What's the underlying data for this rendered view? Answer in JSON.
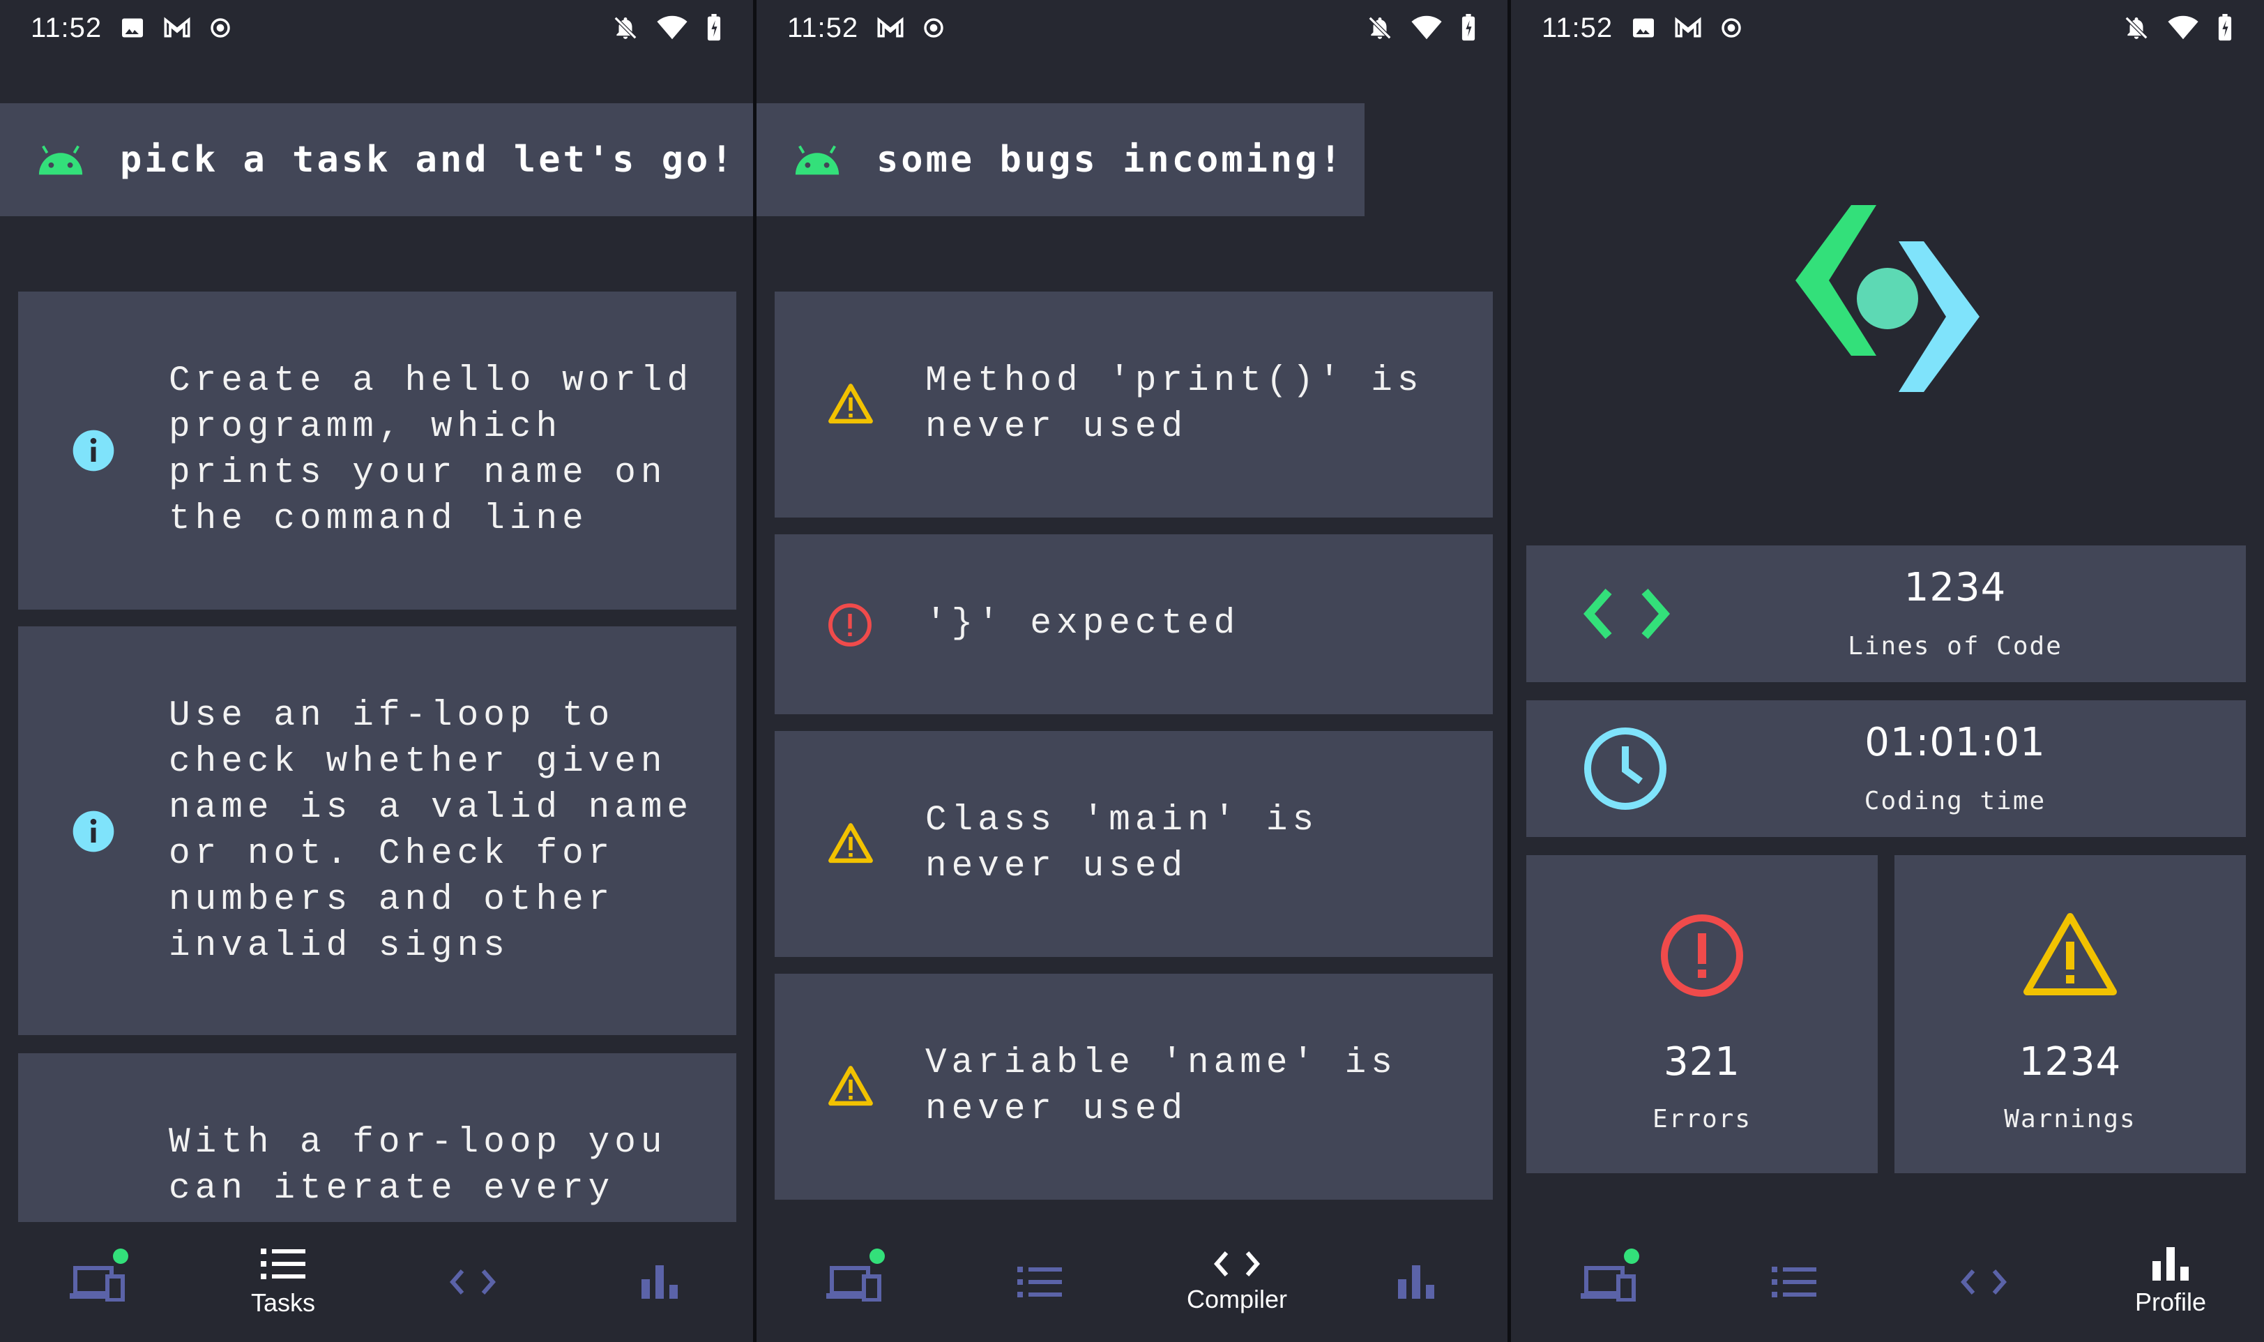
{
  "status_bar": {
    "time": "11:52"
  },
  "colors": {
    "background": "#262831",
    "card": "#424657",
    "accent_green": "#33e07a",
    "accent_cyan": "#7fe3fb",
    "error_red": "#f04b4b",
    "warning_yellow": "#f2c200",
    "nav_inactive": "#5b63a8"
  },
  "tasks_screen": {
    "banner": "pick a task and let's go!",
    "tasks": [
      {
        "icon": "info-icon",
        "text": "Create a hello world\nprogramm, which\nprints your name on\nthe command line"
      },
      {
        "icon": "info-icon",
        "text": "Use an if-loop to\ncheck whether given\nname is a valid name\nor not. Check for\nnumbers and other\ninvalid signs"
      },
      {
        "icon": "none",
        "text": "With a for-loop you\ncan iterate every"
      }
    ]
  },
  "compiler_screen": {
    "banner": "some bugs incoming!",
    "issues": [
      {
        "type": "warning",
        "icon": "warning-icon",
        "text": "Method 'print()' is\nnever used"
      },
      {
        "type": "error",
        "icon": "error-icon",
        "text": "'}' expected"
      },
      {
        "type": "warning",
        "icon": "warning-icon",
        "text": "Class 'main' is\nnever used"
      },
      {
        "type": "warning",
        "icon": "warning-icon",
        "text": "Variable 'name' is\nnever used"
      }
    ]
  },
  "profile_screen": {
    "lines_of_code": {
      "value": "1234",
      "label": "Lines of Code"
    },
    "coding_time": {
      "value": "01:01:01",
      "label": "Coding time"
    },
    "errors": {
      "value": "321",
      "label": "Errors"
    },
    "warnings": {
      "value": "1234",
      "label": "Warnings"
    }
  },
  "bottom_nav": {
    "items": [
      {
        "id": "devices",
        "icon": "devices-icon",
        "label": ""
      },
      {
        "id": "tasks",
        "icon": "list-icon",
        "label": "Tasks"
      },
      {
        "id": "compiler",
        "icon": "code-icon",
        "label": "Compiler"
      },
      {
        "id": "profile",
        "icon": "bar-chart-icon",
        "label": "Profile"
      }
    ]
  }
}
